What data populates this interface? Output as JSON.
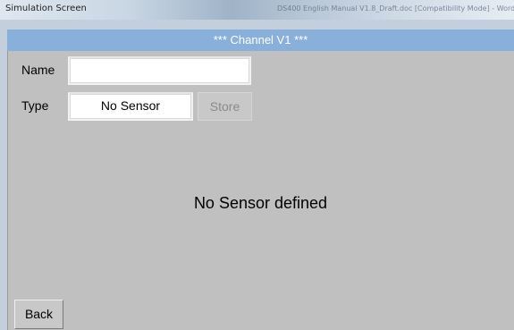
{
  "window": {
    "title": "Simulation Screen",
    "caption_faint": "DS400 English Manual V1.8_Draft.doc [Compatibility Mode] - Word"
  },
  "header": {
    "title": "***   Channel V1   ***"
  },
  "form": {
    "name_label": "Name",
    "name_value": "",
    "type_label": "Type",
    "type_value": "No Sensor",
    "store_label": "Store"
  },
  "main": {
    "message": "No Sensor defined"
  },
  "footer": {
    "back_label": "Back"
  },
  "colors": {
    "header_bg": "#89b0da",
    "panel_bg": "#c0c0c0",
    "disabled_text": "#8a8a8a"
  }
}
